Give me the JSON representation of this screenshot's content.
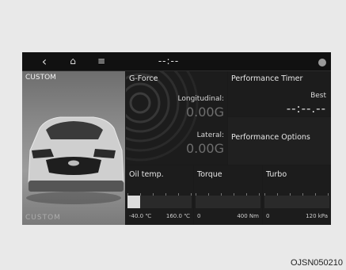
{
  "topbar": {
    "back_icon": "‹",
    "home_icon": "⌂",
    "menu_icon": "≡",
    "title": "--:--"
  },
  "car_panel": {
    "label": "CUSTOM",
    "ghost_label": "CUSTOM"
  },
  "gforce": {
    "title": "G-Force",
    "longitudinal_label": "Longitudinal:",
    "longitudinal_value": "0.00G",
    "lateral_label": "Lateral:",
    "lateral_value": "0.00G"
  },
  "performance_timer": {
    "title": "Performance Timer",
    "best_label": "Best",
    "time_value": "--:--.--"
  },
  "performance_options": {
    "label": "Performance Options"
  },
  "gauges": {
    "oil": {
      "title": "Oil temp.",
      "min": "-40.0 ℃",
      "max": "160.0 ℃",
      "level_fraction": 0.2
    },
    "torque": {
      "title": "Torque",
      "min": "0",
      "max": "400 Nm",
      "level_fraction": 0.0
    },
    "turbo": {
      "title": "Turbo",
      "min": "0",
      "max": "120 kPa",
      "level_fraction": 0.0
    }
  },
  "watermark": "OJSN050210",
  "colors": {
    "screen_bg": "#1a1a1a",
    "text": "#e6e6e6",
    "value_dim": "#6e6e6e"
  }
}
